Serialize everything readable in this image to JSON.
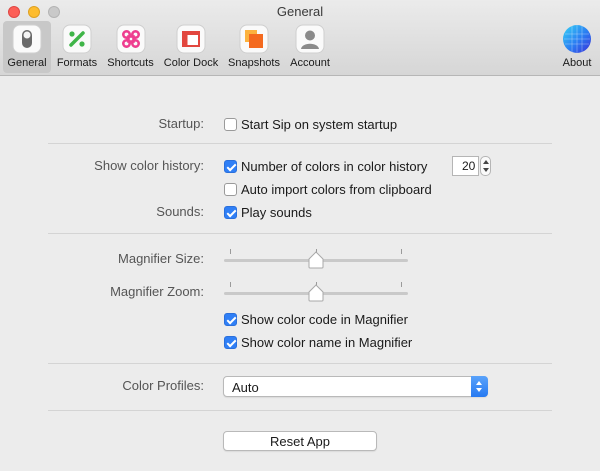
{
  "window": {
    "title": "General"
  },
  "toolbar": {
    "items": [
      {
        "label": "General",
        "icon": "general-toggle-icon",
        "selected": true
      },
      {
        "label": "Formats",
        "icon": "formats-percent-icon"
      },
      {
        "label": "Shortcuts",
        "icon": "shortcuts-command-icon"
      },
      {
        "label": "Color Dock",
        "icon": "color-dock-icon"
      },
      {
        "label": "Snapshots",
        "icon": "snapshots-icon"
      },
      {
        "label": "Account",
        "icon": "account-user-icon"
      }
    ],
    "about": {
      "label": "About",
      "icon": "sip-logo-icon"
    }
  },
  "startup": {
    "label": "Startup:",
    "start_on_startup": {
      "label": "Start Sip on system startup",
      "checked": false
    }
  },
  "history": {
    "label": "Show color history:",
    "number_of_colors": {
      "label": "Number of colors in color history",
      "checked": true,
      "value": "20"
    },
    "auto_import": {
      "label": "Auto import colors from clipboard",
      "checked": false
    }
  },
  "sounds": {
    "label": "Sounds:",
    "play_sounds": {
      "label": "Play sounds",
      "checked": true
    }
  },
  "magnifier": {
    "size_label": "Magnifier Size:",
    "size_value": 0.5,
    "zoom_label": "Magnifier Zoom:",
    "zoom_value": 0.5,
    "show_code": {
      "label": "Show color code in Magnifier",
      "checked": true
    },
    "show_name": {
      "label": "Show color name in Magnifier",
      "checked": true
    }
  },
  "color_profiles": {
    "label": "Color Profiles:",
    "selected": "Auto"
  },
  "reset": {
    "label": "Reset App"
  },
  "colors": {
    "accent": "#2f7ff6",
    "background": "#ececec"
  }
}
